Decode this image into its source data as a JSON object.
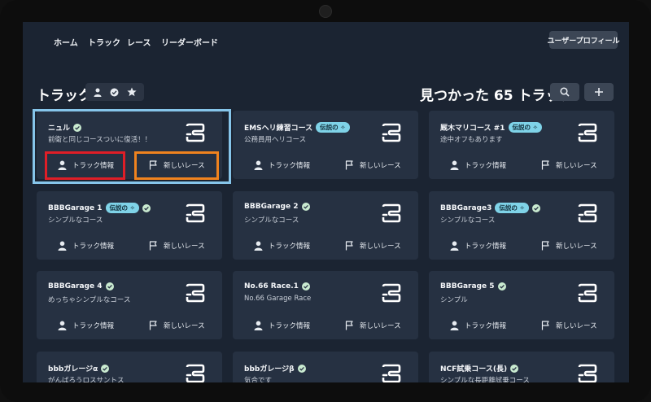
{
  "nav": {
    "items": [
      {
        "label": "ホーム"
      },
      {
        "label": "トラック"
      },
      {
        "label": "レース"
      },
      {
        "label": "リーダーボード"
      }
    ],
    "profile_label": "ユーザープロフィール"
  },
  "header": {
    "title": "トラック",
    "found_text": "見つかった 65 トラック",
    "filters": [
      "person-icon",
      "verified-icon",
      "star-icon"
    ],
    "search_icon": "search-icon",
    "add_icon": "plus-icon"
  },
  "card_labels": {
    "info": "トラック情報",
    "race": "新しいレース"
  },
  "cards": [
    {
      "title": "ニュル",
      "badge": "",
      "verified": true,
      "subtitle": "前衛と同じコースついに復活！！"
    },
    {
      "title": "EMSヘリ練習コース",
      "badge": "伝説の ✧",
      "verified": false,
      "subtitle": "公務員用ヘリコース"
    },
    {
      "title": "厩木マリコース #1",
      "badge": "伝説の ✧",
      "verified": false,
      "subtitle": "途中オフもあります"
    },
    {
      "title": "BBBGarage 1",
      "badge": "伝説の ✧",
      "verified": true,
      "subtitle": "シンプルなコース"
    },
    {
      "title": "BBBGarage 2",
      "badge": "",
      "verified": true,
      "subtitle": "シンプルなコース"
    },
    {
      "title": "BBBGarage3",
      "badge": "伝説の ✧",
      "verified": true,
      "subtitle": "シンプルなコース"
    },
    {
      "title": "BBBGarage 4",
      "badge": "",
      "verified": true,
      "subtitle": "めっちゃシンプルなコース"
    },
    {
      "title": "No.66 Race.1",
      "badge": "",
      "verified": true,
      "subtitle": "No.66 Garage Race"
    },
    {
      "title": "BBBGarage 5",
      "badge": "",
      "verified": true,
      "subtitle": "シンプル"
    },
    {
      "title": "bbbガレージα",
      "badge": "",
      "verified": true,
      "subtitle": "がんばろうロスサントス"
    },
    {
      "title": "bbbガレージβ",
      "badge": "",
      "verified": true,
      "subtitle": "気合です"
    },
    {
      "title": "NCF試乗コース(長)",
      "badge": "",
      "verified": true,
      "subtitle": "シンプルな長距離試乗コース"
    }
  ],
  "colors": {
    "highlight_card": "#86c5ea",
    "highlight_info": "#e01e27",
    "highlight_race": "#f0831e",
    "badge": "#7fd3e8",
    "card_bg": "#263142",
    "screen_bg": "#1b2432"
  }
}
